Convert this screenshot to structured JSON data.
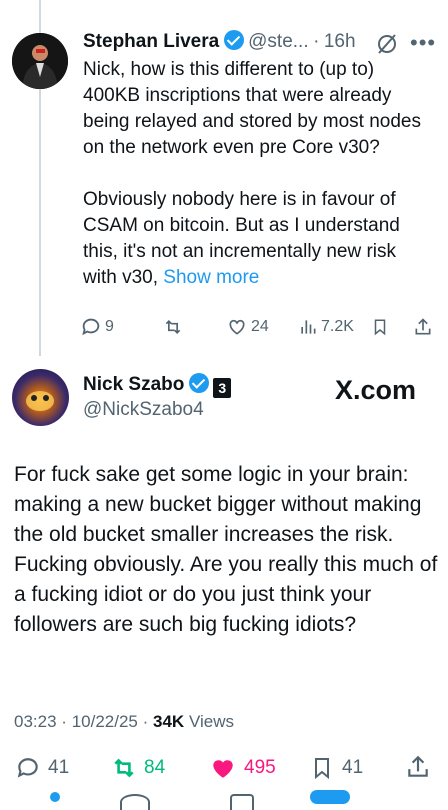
{
  "parent_tweet": {
    "author_name": "Stephan Livera",
    "handle": "@ste...",
    "dot": "·",
    "time": "16h",
    "text": "Nick, how is this different to (up to) 400KB inscriptions that were already being relayed and stored by most nodes on the network even pre Core v30?\n\nObviously nobody here is in favour of CSAM on bitcoin. But as I understand this, it's not an incrementally new risk with v30, ",
    "show_more": "Show more",
    "replies": "9",
    "likes": "24",
    "views": "7.2K"
  },
  "main_tweet": {
    "author_name": "Nick Szabo",
    "handle": "@NickSzabo4",
    "badge": "3",
    "brand": "X.com",
    "text": "For fuck sake get some logic in your brain: making a new bucket bigger without making the old bucket smaller increases the risk.   Fucking obviously. Are you really this much of a fucking idiot or do you just think your followers are such big fucking idiots?",
    "time": "03:23",
    "date": "10/22/25",
    "views_count": "34K",
    "views_label": "Views",
    "replies": "41",
    "reposts": "84",
    "likes": "495",
    "bookmarks": "41"
  },
  "colors": {
    "accent": "#1d9bf0",
    "repost": "#00ba7c",
    "like": "#f91880",
    "muted": "#536471"
  }
}
